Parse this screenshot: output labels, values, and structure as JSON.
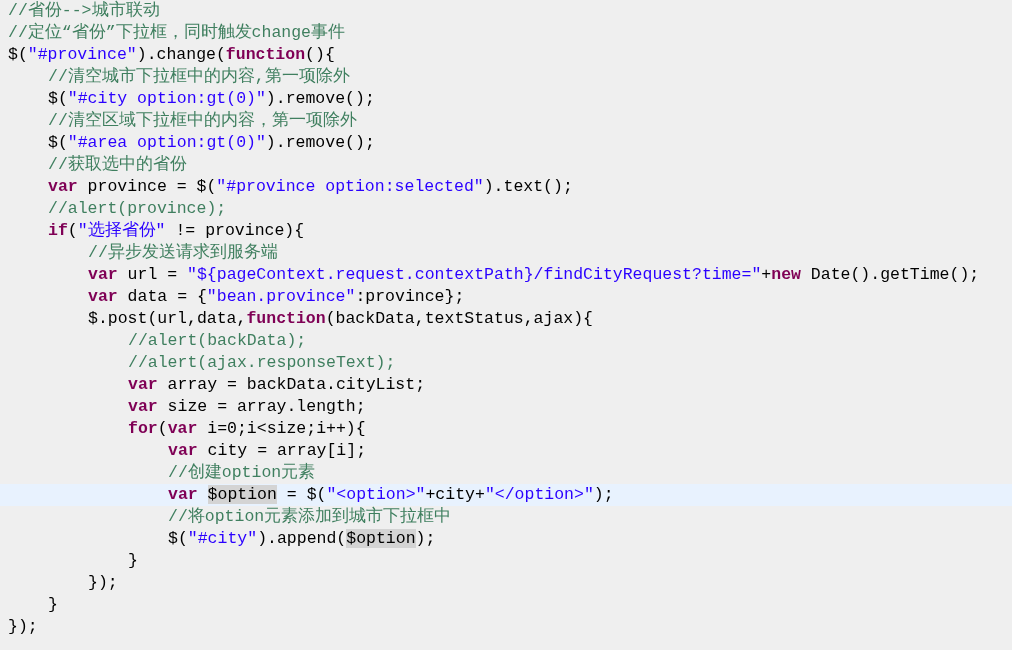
{
  "editor": {
    "lines": [
      {
        "tokens": [
          {
            "kind": "comment",
            "text": "//省份-->城市联动"
          }
        ]
      },
      {
        "tokens": [
          {
            "kind": "comment",
            "text": "//定位“省份”下拉框，同时触发change事件"
          }
        ]
      },
      {
        "tokens": [
          {
            "kind": "plain",
            "text": "$("
          },
          {
            "kind": "string",
            "text": "\"#province\""
          },
          {
            "kind": "plain",
            "text": ").change("
          },
          {
            "kind": "keyword",
            "text": "function"
          },
          {
            "kind": "plain",
            "text": "(){"
          }
        ],
        "children": [
          {
            "tokens": [
              {
                "kind": "comment",
                "text": "//清空城市下拉框中的内容,第一项除外"
              }
            ]
          },
          {
            "tokens": [
              {
                "kind": "plain",
                "text": "$("
              },
              {
                "kind": "string",
                "text": "\"#city option:gt(0)\""
              },
              {
                "kind": "plain",
                "text": ").remove();"
              }
            ]
          },
          {
            "tokens": [
              {
                "kind": "comment",
                "text": "//清空区域下拉框中的内容，第一项除外"
              }
            ]
          },
          {
            "tokens": [
              {
                "kind": "plain",
                "text": "$("
              },
              {
                "kind": "string",
                "text": "\"#area option:gt(0)\""
              },
              {
                "kind": "plain",
                "text": ").remove();"
              }
            ]
          },
          {
            "tokens": [
              {
                "kind": "comment",
                "text": "//获取选中的省份"
              }
            ]
          },
          {
            "tokens": [
              {
                "kind": "keyword",
                "text": "var"
              },
              {
                "kind": "plain",
                "text": " province = $("
              },
              {
                "kind": "string",
                "text": "\"#province option:selected\""
              },
              {
                "kind": "plain",
                "text": ").text();"
              }
            ]
          },
          {
            "tokens": [
              {
                "kind": "comment",
                "text": "//alert(province);"
              }
            ]
          },
          {
            "tokens": [
              {
                "kind": "keyword",
                "text": "if"
              },
              {
                "kind": "plain",
                "text": "("
              },
              {
                "kind": "string",
                "text": "\"选择省份\""
              },
              {
                "kind": "plain",
                "text": " != province){"
              }
            ],
            "children": [
              {
                "tokens": [
                  {
                    "kind": "comment",
                    "text": "//异步发送请求到服务端"
                  }
                ]
              },
              {
                "tokens": [
                  {
                    "kind": "keyword",
                    "text": "var"
                  },
                  {
                    "kind": "plain",
                    "text": " url = "
                  },
                  {
                    "kind": "string",
                    "text": "\"${pageContext.request.contextPath}/findCityRequest?time=\""
                  },
                  {
                    "kind": "plain",
                    "text": "+"
                  },
                  {
                    "kind": "keyword",
                    "text": "new"
                  },
                  {
                    "kind": "plain",
                    "text": " Date().getTime();"
                  }
                ]
              },
              {
                "tokens": [
                  {
                    "kind": "keyword",
                    "text": "var"
                  },
                  {
                    "kind": "plain",
                    "text": " data = {"
                  },
                  {
                    "kind": "string",
                    "text": "\"bean.province\""
                  },
                  {
                    "kind": "plain",
                    "text": ":province};"
                  }
                ]
              },
              {
                "tokens": [
                  {
                    "kind": "plain",
                    "text": "$.post(url,data,"
                  },
                  {
                    "kind": "keyword",
                    "text": "function"
                  },
                  {
                    "kind": "plain",
                    "text": "(backData,textStatus,ajax){"
                  }
                ],
                "children": [
                  {
                    "tokens": [
                      {
                        "kind": "comment",
                        "text": "//alert(backData);"
                      }
                    ]
                  },
                  {
                    "tokens": [
                      {
                        "kind": "comment",
                        "text": "//alert(ajax.responseText);"
                      }
                    ]
                  },
                  {
                    "tokens": [
                      {
                        "kind": "keyword",
                        "text": "var"
                      },
                      {
                        "kind": "plain",
                        "text": " array = backData.cityList;"
                      }
                    ]
                  },
                  {
                    "tokens": [
                      {
                        "kind": "keyword",
                        "text": "var"
                      },
                      {
                        "kind": "plain",
                        "text": " size = array.length;"
                      }
                    ]
                  },
                  {
                    "tokens": [
                      {
                        "kind": "keyword",
                        "text": "for"
                      },
                      {
                        "kind": "plain",
                        "text": "("
                      },
                      {
                        "kind": "keyword",
                        "text": "var"
                      },
                      {
                        "kind": "plain",
                        "text": " i=0;i<size;i++){"
                      }
                    ],
                    "children": [
                      {
                        "tokens": [
                          {
                            "kind": "keyword",
                            "text": "var"
                          },
                          {
                            "kind": "plain",
                            "text": " city = array[i];"
                          }
                        ]
                      },
                      {
                        "tokens": [
                          {
                            "kind": "comment",
                            "text": "//创建option元素"
                          }
                        ]
                      },
                      {
                        "current": true,
                        "tokens": [
                          {
                            "kind": "keyword",
                            "text": "var "
                          },
                          {
                            "kind": "plain",
                            "text": "$option",
                            "highlighted": true
                          },
                          {
                            "kind": "plain",
                            "text": " = $("
                          },
                          {
                            "kind": "string",
                            "text": "\"<option>\""
                          },
                          {
                            "kind": "plain",
                            "text": "+city+"
                          },
                          {
                            "kind": "string",
                            "text": "\"</option>\""
                          },
                          {
                            "kind": "plain",
                            "text": ");"
                          }
                        ]
                      },
                      {
                        "tokens": [
                          {
                            "kind": "comment",
                            "text": "//将option元素添加到城市下拉框中"
                          }
                        ]
                      },
                      {
                        "tokens": [
                          {
                            "kind": "plain",
                            "text": "$("
                          },
                          {
                            "kind": "string",
                            "text": "\"#city\""
                          },
                          {
                            "kind": "plain",
                            "text": ").append("
                          },
                          {
                            "kind": "plain",
                            "text": "$option",
                            "highlighted": true
                          },
                          {
                            "kind": "plain",
                            "text": ");"
                          }
                        ]
                      }
                    ]
                  },
                  {
                    "tokens": [
                      {
                        "kind": "plain",
                        "text": "}"
                      }
                    ]
                  }
                ]
              },
              {
                "tokens": [
                  {
                    "kind": "plain",
                    "text": "});"
                  }
                ]
              }
            ]
          },
          {
            "tokens": [
              {
                "kind": "plain",
                "text": "}"
              }
            ]
          }
        ]
      },
      {
        "tokens": [
          {
            "kind": "plain",
            "text": "});"
          }
        ]
      }
    ]
  }
}
